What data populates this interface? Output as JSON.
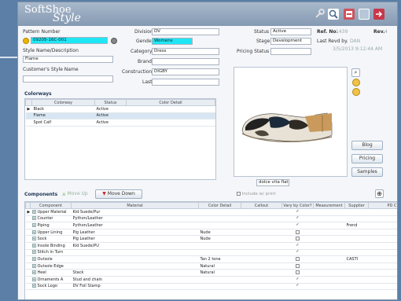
{
  "logo": {
    "line1": "SoftShoe",
    "line2": "Style"
  },
  "header_icons": [
    "wrench-icon",
    "search-icon",
    "print-icon",
    "window-icon",
    "exit-icon"
  ],
  "form": {
    "pattern_number_label": "Pattern Number",
    "pattern_number": "09205-16C-001",
    "style_name_label": "Style Name/Description",
    "style_name": "Flame",
    "customer_style_label": "Customer's Style Name",
    "customer_style": "",
    "extra_field": "",
    "division_label": "Division",
    "division": "DV",
    "gender_label": "Gender",
    "gender": "Womens",
    "category_label": "Category",
    "category": "Dress",
    "brand_label": "Brand",
    "brand": "",
    "construction_label": "Construction",
    "construction": "DIGBY",
    "last_label": "Last",
    "last": "",
    "status_label": "Status",
    "status": "Active",
    "stage_label": "Stage",
    "stage": "Development",
    "pricing_status_label": "Pricing Status",
    "pricing_status": "",
    "ref_no_label": "Ref. No.",
    "ref_no": "1439",
    "rev_label": "Rev.",
    "rev": "4",
    "last_revd_label": "Last Revd by.",
    "last_revd_by": "DAN",
    "last_revd_date": "3/5/2013 9:12:44 AM"
  },
  "colorways": {
    "title": "Colorways",
    "columns": [
      "Colorway",
      "Status",
      "Color Detail"
    ],
    "rows": [
      {
        "name": "Black",
        "status": "Active",
        "detail": ""
      },
      {
        "name": "Flame",
        "status": "Active",
        "detail": ""
      },
      {
        "name": "Spot Calf",
        "status": "Active",
        "detail": ""
      }
    ]
  },
  "image": {
    "caption": "dolce vita flat"
  },
  "side_buttons": {
    "blog": "Blog",
    "pricing": "Pricing",
    "samples": "Samples"
  },
  "components": {
    "title": "Components",
    "move_up": "Move Up",
    "move_down": "Move Down",
    "include_print": "Include w/ print",
    "columns": [
      "Component",
      "Material",
      "Color Detail",
      "Callout",
      "Vary by Color?",
      "Measurement",
      "Supplier",
      "PD C"
    ],
    "rows": [
      {
        "component": "Upper Material",
        "material": "Kid Suede/Pur",
        "color_detail": "",
        "callout": "",
        "vary": true,
        "measurement": "",
        "supplier": ""
      },
      {
        "component": "Counter",
        "material": "Python/Leather",
        "color_detail": "",
        "callout": "",
        "vary": true,
        "measurement": "",
        "supplier": ""
      },
      {
        "component": "Piping",
        "material": "Python/Leather",
        "color_detail": "",
        "callout": "",
        "vary": true,
        "measurement": "",
        "supplier": "Frend"
      },
      {
        "component": "Upper Lining",
        "material": "Pig Leather",
        "color_detail": "Nude",
        "callout": "",
        "vary": false,
        "measurement": "",
        "supplier": ""
      },
      {
        "component": "Sock",
        "material": "Pig Leather",
        "color_detail": "Nude",
        "callout": "",
        "vary": false,
        "measurement": "",
        "supplier": ""
      },
      {
        "component": "Insole Binding",
        "material": "Kid Suede/PU",
        "color_detail": "",
        "callout": "",
        "vary": true,
        "measurement": "",
        "supplier": ""
      },
      {
        "component": "Stitch in Turn",
        "material": "",
        "color_detail": "",
        "callout": "",
        "vary": true,
        "measurement": "",
        "supplier": ""
      },
      {
        "component": "Outsole",
        "material": "",
        "color_detail": "Tan 2 tone",
        "callout": "",
        "vary": false,
        "measurement": "",
        "supplier": "CASTI"
      },
      {
        "component": "Outsole Edge",
        "material": "",
        "color_detail": "Natural",
        "callout": "",
        "vary": false,
        "measurement": "",
        "supplier": ""
      },
      {
        "component": "Heel",
        "material": "Stack",
        "color_detail": "Natural",
        "callout": "",
        "vary": false,
        "measurement": "",
        "supplier": ""
      },
      {
        "component": "Ornaments A",
        "material": "Stud and chain",
        "color_detail": "",
        "callout": "",
        "vary": true,
        "measurement": "",
        "supplier": ""
      },
      {
        "component": "Sock Logo",
        "material": "DV Foil Stamp",
        "color_detail": "",
        "callout": "",
        "vary": true,
        "measurement": "",
        "supplier": ""
      }
    ]
  },
  "colors": {
    "accent_cyan": "#1fe6f5",
    "move_down_red": "#cc2222",
    "frame_blue": "#5b7fa6"
  }
}
